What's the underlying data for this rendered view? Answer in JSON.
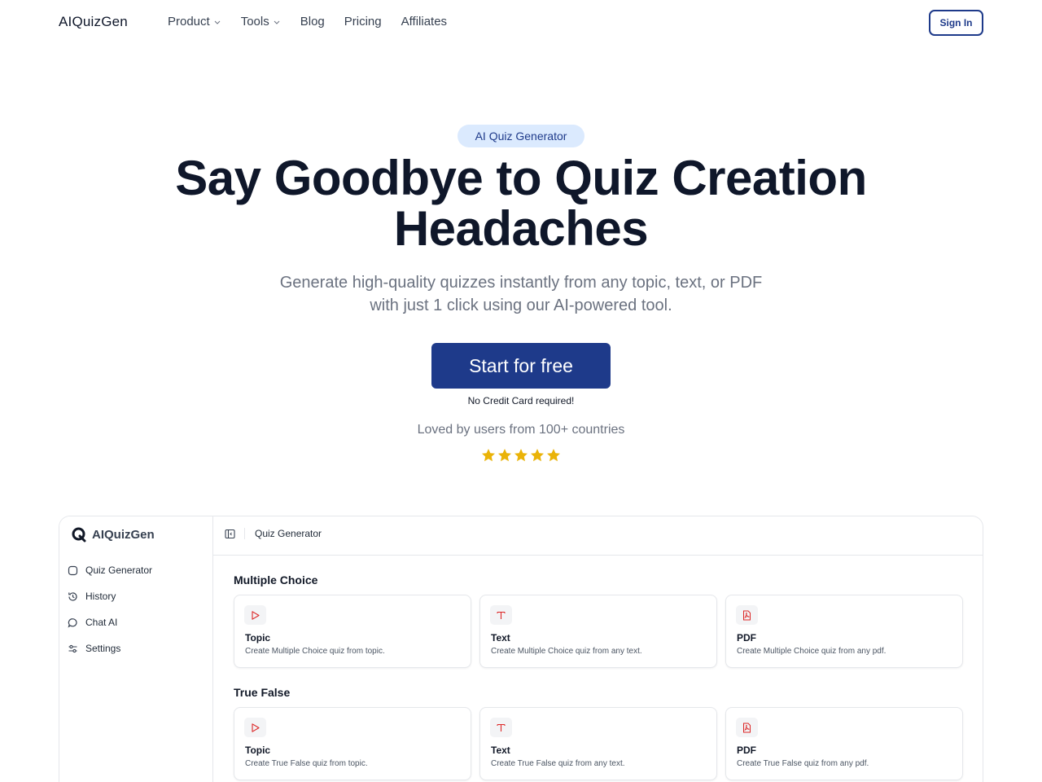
{
  "nav": {
    "logo": "AIQuizGen",
    "links": [
      {
        "label": "Product",
        "dropdown": true
      },
      {
        "label": "Tools",
        "dropdown": true
      },
      {
        "label": "Blog",
        "dropdown": false
      },
      {
        "label": "Pricing",
        "dropdown": false
      },
      {
        "label": "Affiliates",
        "dropdown": false
      }
    ],
    "signin_label": "Sign In"
  },
  "hero": {
    "badge": "AI Quiz Generator",
    "headline_line1": "Say Goodbye to Quiz Creation",
    "headline_line2": "Headaches",
    "subline_line1": "Generate high-quality quizzes instantly from any topic, text, or PDF",
    "subline_line2": "with just 1 click using our AI-powered tool.",
    "cta_label": "Start for free",
    "cta_note": "No Credit Card required!",
    "social_proof": "Loved by users from 100+ countries",
    "rating_stars": 5
  },
  "app_preview": {
    "logo": "AIQuizGen",
    "sidebar": [
      {
        "label": "Quiz Generator",
        "icon": "square-icon"
      },
      {
        "label": "History",
        "icon": "history-icon"
      },
      {
        "label": "Chat AI",
        "icon": "chat-bubble-icon"
      },
      {
        "label": "Settings",
        "icon": "sliders-icon"
      }
    ],
    "topbar_title": "Quiz Generator",
    "sections": [
      {
        "title": "Multiple Choice",
        "cards": [
          {
            "title": "Topic",
            "desc": "Create Multiple Choice quiz from topic.",
            "icon": "play-icon"
          },
          {
            "title": "Text",
            "desc": "Create Multiple Choice quiz from any text.",
            "icon": "text-icon"
          },
          {
            "title": "PDF",
            "desc": "Create Multiple Choice quiz from any pdf.",
            "icon": "pdf-icon"
          }
        ]
      },
      {
        "title": "True False",
        "cards": [
          {
            "title": "Topic",
            "desc": "Create True False quiz from topic.",
            "icon": "play-icon"
          },
          {
            "title": "Text",
            "desc": "Create True False quiz from any text.",
            "icon": "text-icon"
          },
          {
            "title": "PDF",
            "desc": "Create True False quiz from any pdf.",
            "icon": "pdf-icon"
          }
        ]
      }
    ]
  },
  "colors": {
    "brand": "#1e3a8a",
    "badge_bg": "#dbeafe",
    "star": "#eab308",
    "icon_red": "#dc2626",
    "text_dark": "#0f172a",
    "text_muted": "#6b7280"
  }
}
